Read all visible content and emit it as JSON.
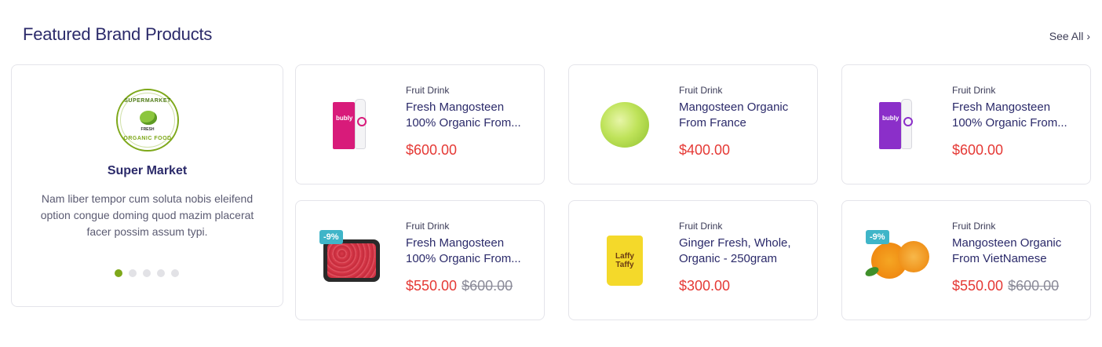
{
  "header": {
    "title": "Featured Brand Products",
    "see_all": "See All",
    "see_all_icon": "chevron-right-icon"
  },
  "brand": {
    "logo_top_text": "SUPERMARKET",
    "logo_mid_text": "FRESH",
    "logo_bottom_text": "ORGANIC FOOD",
    "name": "Super Market",
    "description": "Nam liber tempor cum soluta nobis eleifend option congue doming quod mazim placerat facer possim assum typi.",
    "slides": 5,
    "active_slide": 1,
    "accent_color": "#7ea81a"
  },
  "products": [
    {
      "category": "Fruit Drink",
      "name_line1": "Fresh Mangosteen",
      "name_line2": "100% Organic From...",
      "price": "$600.00",
      "old_price": "",
      "badge": "",
      "image": "bubly-pink-bottle"
    },
    {
      "category": "Fruit Drink",
      "name_line1": "Mangosteen Organic",
      "name_line2": "From France",
      "price": "$400.00",
      "old_price": "",
      "badge": "",
      "image": "cabbage"
    },
    {
      "category": "Fruit Drink",
      "name_line1": "Fresh Mangosteen",
      "name_line2": "100% Organic From...",
      "price": "$600.00",
      "old_price": "",
      "badge": "",
      "image": "bubly-purple-bottle"
    },
    {
      "category": "Fruit Drink",
      "name_line1": "Fresh Mangosteen",
      "name_line2": "100% Organic From...",
      "price": "$550.00",
      "old_price": "$600.00",
      "badge": "-9%",
      "image": "meat-tray"
    },
    {
      "category": "Fruit Drink",
      "name_line1": "Ginger Fresh, Whole,",
      "name_line2": "Organic - 250gram",
      "price": "$300.00",
      "old_price": "",
      "badge": "",
      "image": "laffy-taffy"
    },
    {
      "category": "Fruit Drink",
      "name_line1": "Mangosteen Organic",
      "name_line2": "From VietNamese",
      "price": "$550.00",
      "old_price": "$600.00",
      "badge": "-9%",
      "image": "apricots"
    }
  ],
  "image_text": {
    "bubly": "bubly",
    "taffy_line1": "Laffy",
    "taffy_line2": "Taffy"
  },
  "colors": {
    "price": "#e53935",
    "title": "#2b2a6a",
    "badge": "#3fb5c8",
    "pink": "#d81b7a",
    "purple": "#8b2fc9"
  }
}
